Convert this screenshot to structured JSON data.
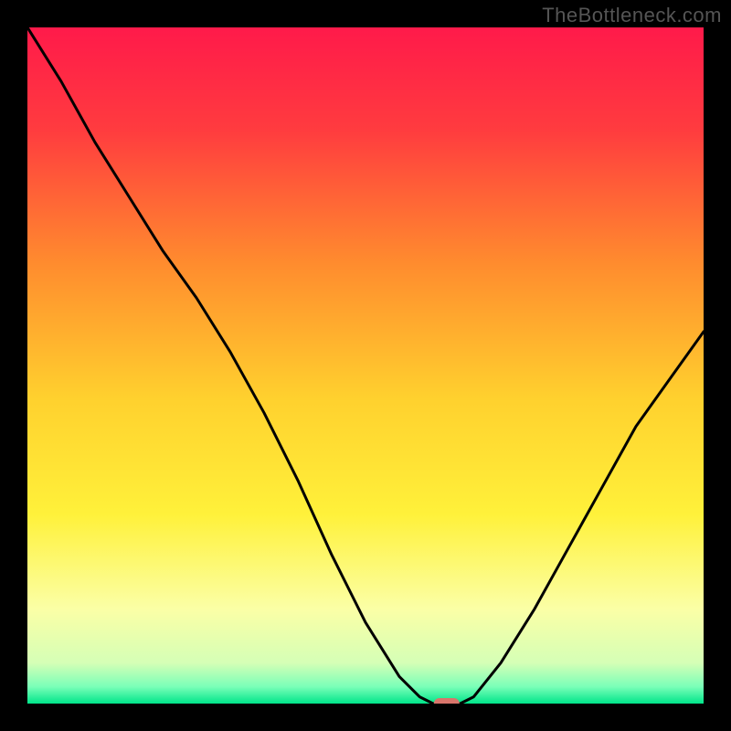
{
  "watermark": "TheBottleneck.com",
  "chart_data": {
    "type": "line",
    "title": "",
    "xlabel": "",
    "ylabel": "",
    "xlim": [
      0,
      100
    ],
    "ylim": [
      0,
      100
    ],
    "background": {
      "type": "vertical-gradient",
      "stops": [
        {
          "pos": 0.0,
          "color": "#ff1a4a"
        },
        {
          "pos": 0.15,
          "color": "#ff3b3f"
        },
        {
          "pos": 0.35,
          "color": "#ff8c2e"
        },
        {
          "pos": 0.55,
          "color": "#ffd12e"
        },
        {
          "pos": 0.72,
          "color": "#fff13a"
        },
        {
          "pos": 0.86,
          "color": "#fbffa6"
        },
        {
          "pos": 0.94,
          "color": "#d5ffb6"
        },
        {
          "pos": 0.975,
          "color": "#7affb8"
        },
        {
          "pos": 1.0,
          "color": "#00e58a"
        }
      ]
    },
    "series": [
      {
        "name": "bottleneck-curve",
        "stroke": "#000000",
        "x": [
          0,
          5,
          10,
          15,
          20,
          25,
          30,
          35,
          40,
          45,
          50,
          55,
          58,
          60,
          62,
          64,
          66,
          70,
          75,
          80,
          85,
          90,
          95,
          100
        ],
        "values": [
          100,
          92,
          83,
          75,
          67,
          60,
          52,
          43,
          33,
          22,
          12,
          4,
          1,
          0,
          0,
          0,
          1,
          6,
          14,
          23,
          32,
          41,
          48,
          55
        ]
      }
    ],
    "marker": {
      "name": "optimal-point",
      "x": 62,
      "y": 0,
      "color": "#d9756b",
      "shape": "rounded-rect"
    }
  }
}
